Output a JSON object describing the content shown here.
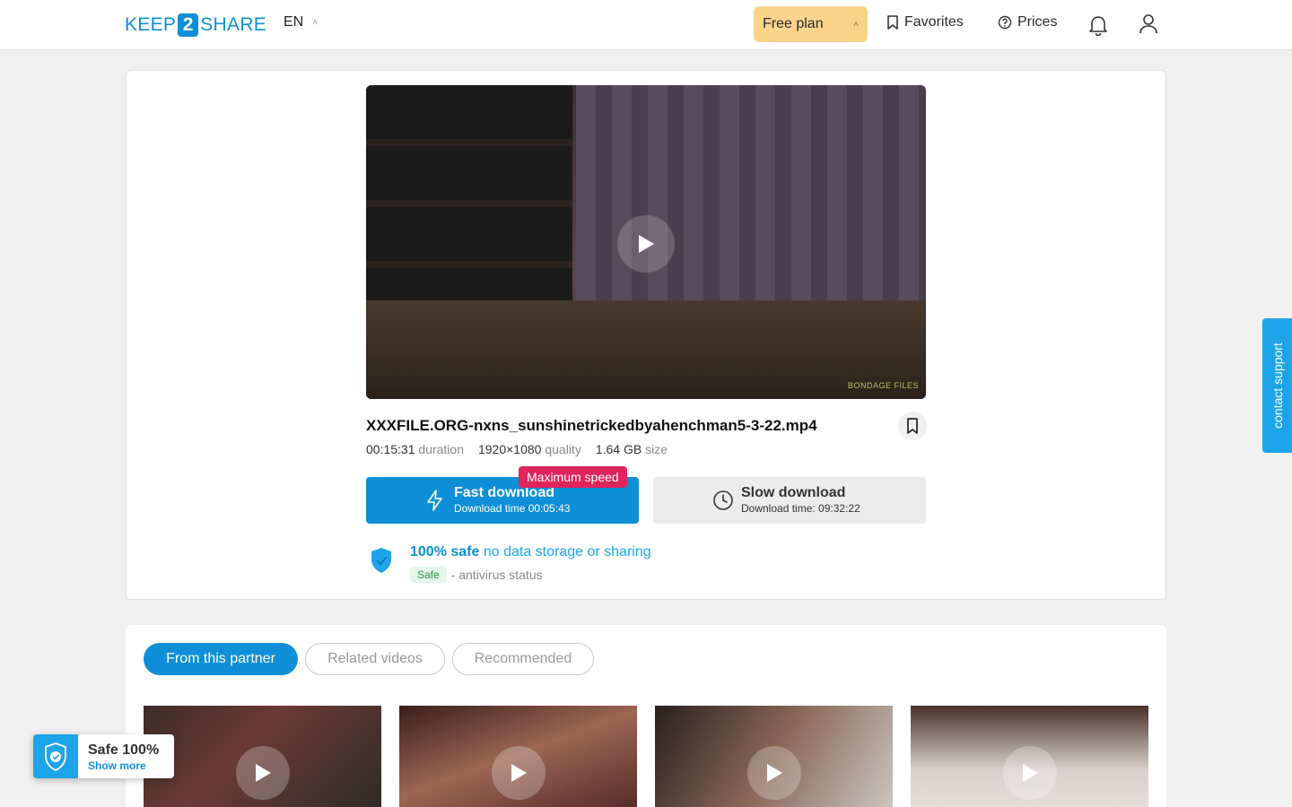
{
  "header": {
    "logo": {
      "left": "KEEP",
      "mid": "2",
      "right": "SHARE"
    },
    "language": "EN",
    "plan_label": "Free plan",
    "favorites_label": "Favorites",
    "prices_label": "Prices",
    "icons": [
      "bell-icon",
      "user-icon",
      "bookmark-icon",
      "help-circle-icon"
    ]
  },
  "file": {
    "name": "XXXFILE.ORG-nxns_sunshinetrickedbyahenchman5-3-22.mp4",
    "duration_value": "00:15:31",
    "duration_label": "duration",
    "quality_value": "1920×1080",
    "quality_label": "quality",
    "size_value": "1.64 GB",
    "size_label": "size",
    "watermark": "BONDAGE FILES"
  },
  "download": {
    "fast_title": "Fast download",
    "fast_sub": "Download time 00:05:43",
    "max_badge": "Maximum speed",
    "slow_title": "Slow download",
    "slow_sub": "Download time: 09:32:22"
  },
  "safety": {
    "bold": "100% safe",
    "rest": "no data storage or sharing",
    "badge": "Safe",
    "status": "- antivirus status"
  },
  "tabs": [
    {
      "label": "From this partner",
      "active": true
    },
    {
      "label": "Related videos",
      "active": false
    },
    {
      "label": "Recommended",
      "active": false
    }
  ],
  "support_label": "contact support",
  "safe_widget": {
    "title": "Safe 100%",
    "link": "Show more"
  },
  "colors": {
    "accent": "#0e8fd7",
    "plan": "#fbd38a",
    "badge": "#e0245e",
    "support": "#1ea4e9"
  }
}
